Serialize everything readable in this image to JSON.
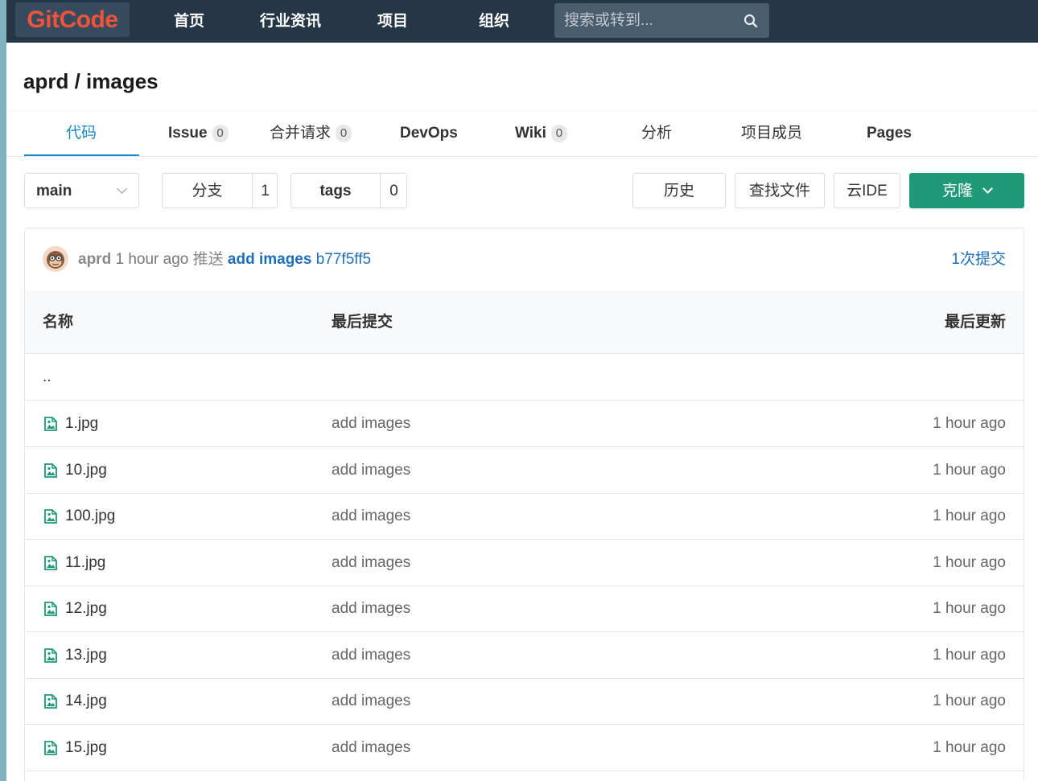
{
  "nav": {
    "logo": "GitCode",
    "items": [
      "首页",
      "行业资讯",
      "项目",
      "组织"
    ],
    "search_placeholder": "搜索或转到..."
  },
  "project": {
    "title": "aprd / images"
  },
  "tabs": [
    {
      "label": "代码",
      "badge": null
    },
    {
      "label": "Issue",
      "badge": "0"
    },
    {
      "label": "合并请求",
      "badge": "0"
    },
    {
      "label": "DevOps",
      "badge": null
    },
    {
      "label": "Wiki",
      "badge": "0"
    },
    {
      "label": "分析",
      "badge": null
    },
    {
      "label": "项目成员",
      "badge": null
    },
    {
      "label": "Pages",
      "badge": null
    }
  ],
  "toolbar": {
    "branch": "main",
    "branches_label": "分支",
    "branches_count": "1",
    "tags_label": "tags",
    "tags_count": "0",
    "history": "历史",
    "find_file": "查找文件",
    "cloud_ide": "云IDE",
    "clone": "克隆"
  },
  "commit": {
    "author": "aprd",
    "time": "1 hour ago",
    "action": "推送",
    "message": "add images",
    "hash": "b77f5ff5",
    "count": "1次提交"
  },
  "table": {
    "headers": [
      "名称",
      "最后提交",
      "最后更新"
    ],
    "parent": "..",
    "rows": [
      {
        "name": "1.jpg",
        "message": "add images",
        "time": "1 hour ago"
      },
      {
        "name": "10.jpg",
        "message": "add images",
        "time": "1 hour ago"
      },
      {
        "name": "100.jpg",
        "message": "add images",
        "time": "1 hour ago"
      },
      {
        "name": "11.jpg",
        "message": "add images",
        "time": "1 hour ago"
      },
      {
        "name": "12.jpg",
        "message": "add images",
        "time": "1 hour ago"
      },
      {
        "name": "13.jpg",
        "message": "add images",
        "time": "1 hour ago"
      },
      {
        "name": "14.jpg",
        "message": "add images",
        "time": "1 hour ago"
      },
      {
        "name": "15.jpg",
        "message": "add images",
        "time": "1 hour ago"
      }
    ]
  },
  "colors": {
    "nav_bg": "#253746",
    "logo": "#f0533a",
    "accent": "#1e88c7",
    "clone": "#1f9977",
    "link": "#1e6fb8"
  }
}
